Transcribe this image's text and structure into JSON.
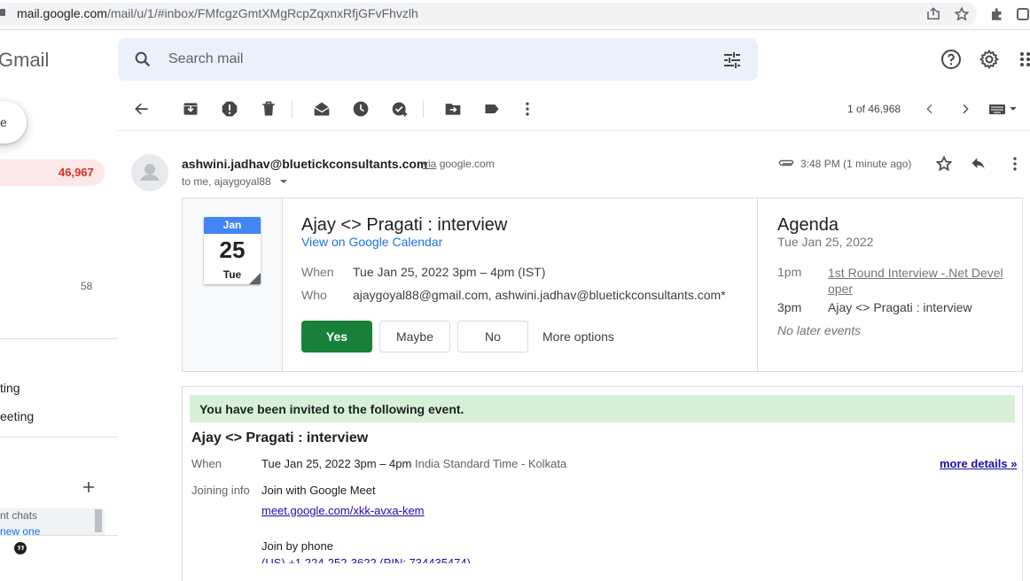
{
  "browser": {
    "url_host": "mail.google.com",
    "url_path": "/mail/u/1/#inbox/FMfcgzGmtXMgRcpZqxnxRfjGFvFhvzlh"
  },
  "app": {
    "logo_text": "Gmail"
  },
  "search": {
    "placeholder": "Search mail"
  },
  "nav": {
    "compose_label": "e",
    "inbox_count": "46,967",
    "other_count": "58",
    "labels": [
      "ting",
      "eeting"
    ],
    "chats_text": "nt chats",
    "chats_link": "new one"
  },
  "toolbar": {
    "page_count": "1 of 46,968"
  },
  "message": {
    "sender": "ashwini.jadhav@bluetickconsultants.com",
    "via_word": "via",
    "via_domain": "google.com",
    "to_line": "to me, ajaygoyal88",
    "time": "3:48 PM (1 minute ago)"
  },
  "invite": {
    "month": "Jan",
    "day": "25",
    "weekday": "Tue",
    "title": "Ajay <> Pragati : interview",
    "calendar_link": "View on Google Calendar",
    "when_label": "When",
    "when_value": "Tue Jan 25, 2022 3pm – 4pm (IST)",
    "who_label": "Who",
    "who_value": "ajaygoyal88@gmail.com, ashwini.jadhav@bluetickconsultants.com*",
    "rsvp": {
      "yes": "Yes",
      "maybe": "Maybe",
      "no": "No",
      "more": "More options"
    }
  },
  "agenda": {
    "title": "Agenda",
    "date": "Tue Jan 25, 2022",
    "items": [
      {
        "time": "1pm",
        "event": "1st Round Interview -.Net Devel oper"
      },
      {
        "time": "3pm",
        "event": "Ajay <> Pragati : interview"
      }
    ],
    "no_later": "No later events"
  },
  "body": {
    "banner": "You have been invited to the following event.",
    "title": "Ajay <> Pragati : interview",
    "when_label": "When",
    "when_value": "Tue Jan 25, 2022 3pm – 4pm",
    "when_tz": "India Standard Time - Kolkata",
    "more_details": "more details »",
    "joining_label": "Joining info",
    "join_meet": "Join with Google Meet",
    "meet_link": "meet.google.com/xkk-avxa-kem",
    "join_phone": "Join by phone",
    "phone_partial": "(US) +1 224-252-3622 (PIN: 734435474)"
  },
  "colors": {
    "accent": "#1a73e8",
    "yes_green": "#188038",
    "inbox_red": "#d93025",
    "banner_green": "#d6f1d7"
  }
}
